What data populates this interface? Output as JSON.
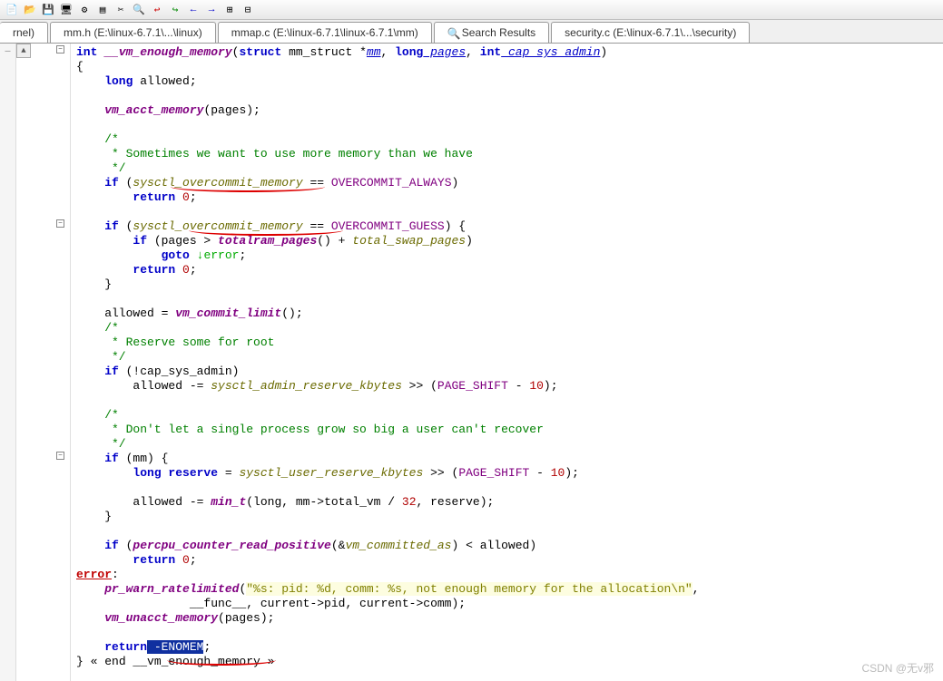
{
  "tabs": [
    {
      "label": "rnel)"
    },
    {
      "label": "mm.h (E:\\linux-6.7.1\\...\\linux)"
    },
    {
      "label": "mmap.c (E:\\linux-6.7.1\\linux-6.7.1\\mm)"
    },
    {
      "label": "Search Results",
      "icon": "search"
    },
    {
      "label": "security.c (E:\\linux-6.7.1\\...\\security)"
    }
  ],
  "watermark": "CSDN @无v邪",
  "code": {
    "fn_ret": "int ",
    "fn_name": "__vm_enough_memory",
    "fn_params_prefix": "(",
    "p_struct": "struct",
    "p_mmstruct": " mm_struct *",
    "p_mm": "mm",
    "p_comma1": ", ",
    "p_long": "long",
    "p_pages": " pages",
    "p_comma2": ", ",
    "p_int": "int",
    "p_cap": " cap_sys_admin",
    "p_rparen": ")",
    "obrace": "{",
    "decl_long": "    long",
    "decl_allowed": " allowed;",
    "call_vmacct": "    vm_acct_memory",
    "call_vmacct_arg": "(pages);",
    "c1a": "    /*",
    "c1b": "     * Sometimes we want to use more memory than we have",
    "c1c": "     */",
    "if1": "    if",
    "if1_open": " (",
    "sysctl_om": "sysctl_overcommit_memory",
    "if1_eq": " == ",
    "oc_always": "OVERCOMMIT_ALWAYS",
    "if1_close": ")",
    "return0": "        return ",
    "zero": "0",
    "semi": ";",
    "if2": "    if",
    "if2_open": " (",
    "if2_eq": " == ",
    "oc_guess": "OVERCOMMIT_GUESS",
    "if2_close": ") {",
    "if2a": "        if",
    "if2a_open": " (pages > ",
    "totalram": "totalram_pages",
    "if2a_mid": "() + ",
    "totswap": "total_swap_pages",
    "if2a_close": ")",
    "goto": "            goto",
    "goto_arrow": " ↓",
    "goto_err": "error",
    "return0b": "        return ",
    "cbrace": "    }",
    "allowed_eq": "    allowed = ",
    "vmcommit": "vm_commit_limit",
    "vmcommit_call": "();",
    "c2a": "    /*",
    "c2b": "     * Reserve some for root",
    "c2c": "     */",
    "if3": "    if",
    "if3_open": " (!cap_sys_admin)",
    "if3_body": "        allowed -= ",
    "sysctl_ark": "sysctl_admin_reserve_kbytes",
    "if3_shift": " >> (",
    "pageshift": "PAGE_SHIFT",
    "if3_minus": " - ",
    "ten": "10",
    "rparen_semi": ");",
    "c3a": "    /*",
    "c3b": "     * Don't let a single process grow so big a user can't recover",
    "c3c": "     */",
    "if4": "    if",
    "if4_open": " (mm) {",
    "if4_decl": "        long",
    "if4_reserve": " reserve",
    "if4_eq": " = ",
    "sysctl_urk": "sysctl_user_reserve_kbytes",
    "if4_shift": " >> (",
    "if4_allowed": "        allowed -= ",
    "min_t": "min_t",
    "if4_min_args": "(long, mm->total_vm / ",
    "thirtytwo": "32",
    "if4_end": ", reserve);",
    "if5": "    if",
    "if5_open": " (",
    "percpu": "percpu_counter_read_positive",
    "if5_mid": "(&",
    "vmcommitted": "vm_committed_as",
    "if5_close": ") < allowed)",
    "err_label": "error",
    "err_colon": ":",
    "pr_warn": "    pr_warn_ratelimited",
    "pr_str": "\"%s: pid: %d, comm: %s, not enough memory for the allocation\\n\"",
    "pr_args_pre": "                __func__, current->pid, current->comm);",
    "vm_unacct": "    vm_unacct_memory",
    "vm_unacct_arg": "(pages);",
    "return_last": "    return",
    "enomem": " -ENOMEM",
    "end_brace": "} ",
    "end_cm": "« end __vm_enough_memory »"
  }
}
